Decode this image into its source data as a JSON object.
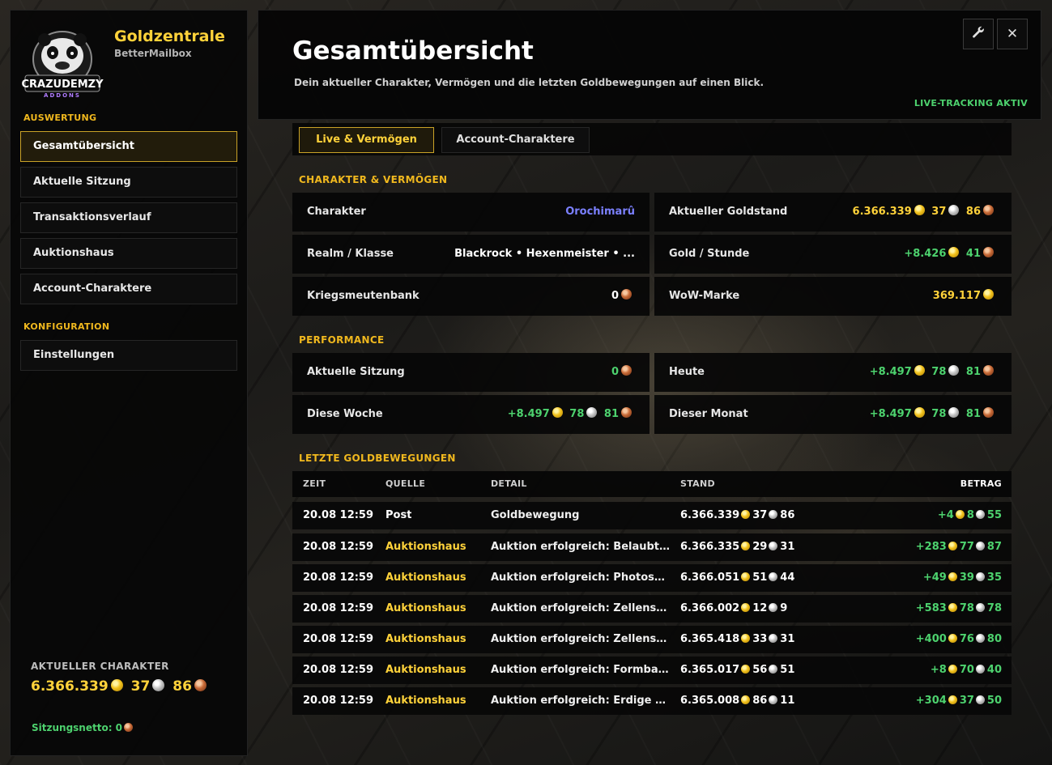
{
  "app": {
    "title": "Goldzentrale",
    "subtitle": "BetterMailbox",
    "logo_text": "CRAZUDEMZY",
    "logo_subtext": "ADDONS"
  },
  "sidebar": {
    "section_auswertung": "AUSWERTUNG",
    "section_konfiguration": "KONFIGURATION",
    "items": [
      {
        "label": "Gesamtübersicht",
        "active": true
      },
      {
        "label": "Aktuelle Sitzung"
      },
      {
        "label": "Transaktionsverlauf"
      },
      {
        "label": "Auktionshaus"
      },
      {
        "label": "Account-Charaktere"
      }
    ],
    "config_items": [
      {
        "label": "Einstellungen"
      }
    ],
    "current_char_label": "AKTUELLER CHARAKTER",
    "current_char_gold": "6.366.339",
    "current_char_silver": "37",
    "current_char_copper": "86",
    "session_net_label": "Sitzungsnetto: 0"
  },
  "header": {
    "title": "Gesamtübersicht",
    "description": "Dein aktueller Charakter, Vermögen und die letzten Goldbewegungen auf einen Blick.",
    "live_tracking": "LIVE-TRACKING AKTIV",
    "settings_icon": "wrench-icon",
    "close_icon": "close-icon"
  },
  "tabs": [
    {
      "label": "Live & Vermögen",
      "active": true
    },
    {
      "label": "Account-Charaktere"
    }
  ],
  "character_section": {
    "title": "CHARAKTER & VERMÖGEN",
    "character_label": "Charakter",
    "character_value": "Orochimarû",
    "goldstand_label": "Aktueller Goldstand",
    "goldstand_gold": "6.366.339",
    "goldstand_silver": "37",
    "goldstand_copper": "86",
    "realm_label": "Realm / Klasse",
    "realm_value": "Blackrock  •  Hexenmeister  • ...",
    "gph_label": "Gold / Stunde",
    "gph_gold": "+8.426",
    "gph_copper": "41",
    "warband_label": "Kriegsmeutenbank",
    "warband_copper": "0",
    "token_label": "WoW-Marke",
    "token_gold": "369.117"
  },
  "performance_section": {
    "title": "PERFORMANCE",
    "session_label": "Aktuelle Sitzung",
    "session_copper": "0",
    "today_label": "Heute",
    "today_gold": "+8.497",
    "today_silver": "78",
    "today_copper": "81",
    "week_label": "Diese Woche",
    "week_gold": "+8.497",
    "week_silver": "78",
    "week_copper": "81",
    "month_label": "Dieser Monat",
    "month_gold": "+8.497",
    "month_silver": "78",
    "month_copper": "81"
  },
  "transactions": {
    "title": "LETZTE GOLDBEWEGUNGEN",
    "columns": {
      "time": "ZEIT",
      "source": "QUELLE",
      "detail": "DETAIL",
      "stand": "STAND",
      "amount": "BETRAG"
    },
    "rows": [
      {
        "time": "20.08 12:59",
        "source": "Post",
        "detail": "Goldbewegung",
        "stand_g": "6.366.339",
        "stand_s": "37",
        "stand_c": "86",
        "amt_g": "+4",
        "amt_s": "8",
        "amt_c": "55"
      },
      {
        "time": "20.08 12:59",
        "source": "Auktionshaus",
        "detail": "Auktion erfolgreich: Belaubte Glie...",
        "stand_g": "6.366.335",
        "stand_s": "29",
        "stand_c": "31",
        "amt_g": "+283",
        "amt_s": "77",
        "amt_c": "87"
      },
      {
        "time": "20.08 12:59",
        "source": "Auktionshaus",
        "detail": "Auktion erfolgreich: Photosynthes...",
        "stand_g": "6.366.051",
        "stand_s": "51",
        "stand_c": "44",
        "amt_g": "+49",
        "amt_s": "39",
        "amt_c": "35"
      },
      {
        "time": "20.08 12:59",
        "source": "Auktionshaus",
        "detail": "Auktion erfolgreich: Zellenscheibe...",
        "stand_g": "6.366.002",
        "stand_s": "12",
        "stand_c": "9",
        "amt_g": "+583",
        "amt_s": "78",
        "amt_c": "78"
      },
      {
        "time": "20.08 12:59",
        "source": "Auktionshaus",
        "detail": "Auktion erfolgreich: Zellenscheibe...",
        "stand_g": "6.365.418",
        "stand_s": "33",
        "stand_c": "31",
        "amt_g": "+400",
        "amt_s": "76",
        "amt_c": "80"
      },
      {
        "time": "20.08 12:59",
        "source": "Auktionshaus",
        "detail": "Auktion erfolgreich: Formbare Wu...",
        "stand_g": "6.365.017",
        "stand_s": "56",
        "stand_c": "51",
        "amt_g": "+8",
        "amt_s": "70",
        "amt_c": "40"
      },
      {
        "time": "20.08 12:59",
        "source": "Auktionshaus",
        "detail": "Auktion erfolgreich: Erdige Beilag...",
        "stand_g": "6.365.008",
        "stand_s": "86",
        "stand_c": "11",
        "amt_g": "+304",
        "amt_s": "37",
        "amt_c": "50"
      }
    ]
  },
  "colors": {
    "accent_gold": "#ffd23a",
    "positive": "#4dd26e",
    "character_name": "#7b80ff",
    "active_border": "#c9a227"
  }
}
